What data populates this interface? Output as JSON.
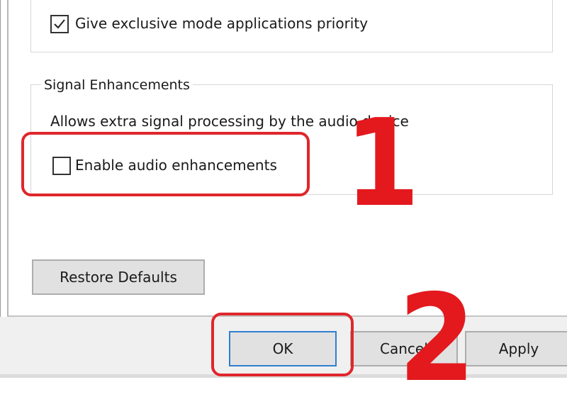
{
  "exclusive_mode": {
    "checkbox_label": "Give exclusive mode applications priority",
    "checked": true
  },
  "signal_enhancements": {
    "group_title": "Signal Enhancements",
    "description": "Allows extra signal processing by the audio device",
    "checkbox_label": "Enable audio enhancements",
    "checked": false
  },
  "buttons": {
    "restore_defaults": "Restore Defaults",
    "ok": "OK",
    "cancel": "Cancel",
    "apply": "Apply"
  },
  "annotations": {
    "step_1": "1",
    "step_2": "2",
    "color": "#e0262b"
  },
  "colors": {
    "button_face": "#e1e1e1",
    "button_border": "#adadad",
    "focus_border": "#2f7fd0",
    "footer_bg": "#f0f0f0"
  },
  "icons": {
    "checkmark": "check-icon"
  }
}
